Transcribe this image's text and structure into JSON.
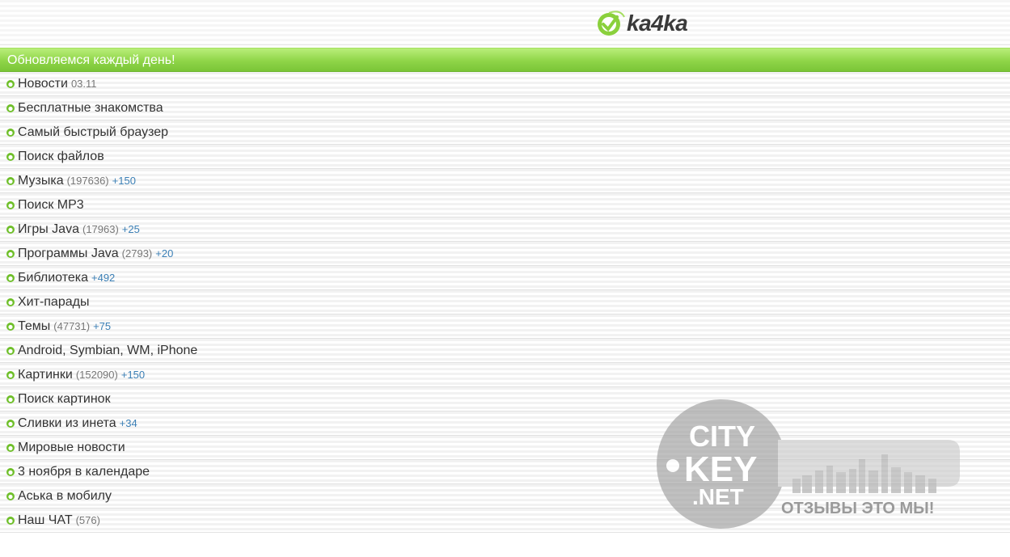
{
  "header": {
    "logo_text": "ka4ka",
    "logo_icon": "leaf-circle-icon"
  },
  "banner": {
    "text": "Обновляемся каждый день!"
  },
  "menu": [
    {
      "label": "Новости",
      "count": "",
      "new": "",
      "date": "03.11"
    },
    {
      "label": "Бесплатные знакомства",
      "count": "",
      "new": "",
      "date": ""
    },
    {
      "label": "Самый быстрый браузер",
      "count": "",
      "new": "",
      "date": ""
    },
    {
      "label": "Поиск файлов",
      "count": "",
      "new": "",
      "date": ""
    },
    {
      "label": "Музыка",
      "count": "(197636)",
      "new": "+150",
      "date": ""
    },
    {
      "label": "Поиск MP3",
      "count": "",
      "new": "",
      "date": ""
    },
    {
      "label": "Игры Java",
      "count": "(17963)",
      "new": "+25",
      "date": ""
    },
    {
      "label": "Программы Java",
      "count": "(2793)",
      "new": "+20",
      "date": ""
    },
    {
      "label": "Библиотека",
      "count": "",
      "new": "+492",
      "date": ""
    },
    {
      "label": "Хит-парады",
      "count": "",
      "new": "",
      "date": ""
    },
    {
      "label": "Темы",
      "count": "(47731)",
      "new": "+75",
      "date": ""
    },
    {
      "label": "Android, Symbian, WM, iPhone",
      "count": "",
      "new": "",
      "date": ""
    },
    {
      "label": "Картинки",
      "count": "(152090)",
      "new": "+150",
      "date": ""
    },
    {
      "label": "Поиск картинок",
      "count": "",
      "new": "",
      "date": ""
    },
    {
      "label": "Сливки из инета",
      "count": "",
      "new": "+34",
      "date": ""
    },
    {
      "label": "Мировые новости",
      "count": "",
      "new": "",
      "date": ""
    },
    {
      "label": "3 ноября в календаре",
      "count": "",
      "new": "",
      "date": ""
    },
    {
      "label": "Аська в мобилу",
      "count": "",
      "new": "",
      "date": ""
    },
    {
      "label": "Наш ЧАТ",
      "count": "(576)",
      "new": "",
      "date": ""
    }
  ],
  "watermark": {
    "line1": "CITY",
    "line2": "KEY",
    "line3": ".NET",
    "slogan": "ОТЗЫВЫ ЭТО МЫ!"
  },
  "colors": {
    "banner_green": "#8fd548",
    "bullet_green": "#6fbf2a",
    "new_blue": "#3b7fb5",
    "watermark_gray": "#9a9a9a"
  }
}
